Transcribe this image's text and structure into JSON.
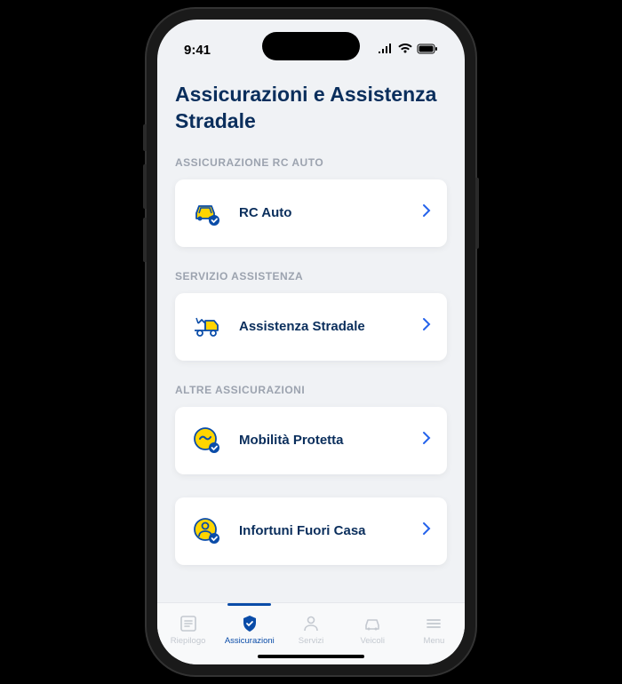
{
  "status_bar": {
    "time": "9:41"
  },
  "page": {
    "title": "Assicurazioni e Assistenza Stradale"
  },
  "sections": [
    {
      "header": "ASSICURAZIONE RC AUTO",
      "items": [
        {
          "icon": "car-shield-icon",
          "title": "RC Auto"
        }
      ]
    },
    {
      "header": "SERVIZIO ASSISTENZA",
      "items": [
        {
          "icon": "tow-truck-icon",
          "title": "Assistenza Stradale"
        }
      ]
    },
    {
      "header": "ALTRE ASSICURAZIONI",
      "items": [
        {
          "icon": "mobility-shield-icon",
          "title": "Mobilità Protetta"
        },
        {
          "icon": "person-shield-icon",
          "title": "Infortuni Fuori Casa"
        }
      ]
    }
  ],
  "tabs": [
    {
      "icon": "list-icon",
      "label": "Riepilogo",
      "active": false
    },
    {
      "icon": "shield-check-icon",
      "label": "Assicurazioni",
      "active": true
    },
    {
      "icon": "person-icon",
      "label": "Servizi",
      "active": false
    },
    {
      "icon": "car-icon",
      "label": "Veicoli",
      "active": false
    },
    {
      "icon": "menu-icon",
      "label": "Menu",
      "active": false
    }
  ]
}
